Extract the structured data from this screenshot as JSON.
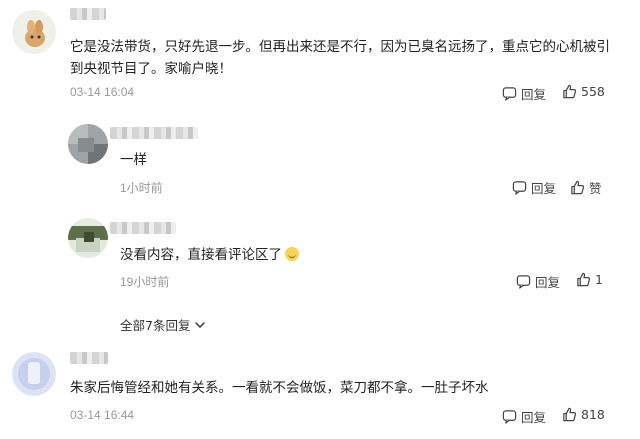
{
  "comments": [
    {
      "text": "它是没法带货，只好先退一步。但再出来还是不行，因为已臭名远扬了，重点它的心机被引到央视节目了。家喻户晓！",
      "time": "03-14 16:04",
      "reply_label": "回复",
      "like_count": "558"
    },
    {
      "text": "一样",
      "time": "1小时前",
      "reply_label": "回复",
      "like_count": "赞"
    },
    {
      "text": "没看内容，直接看评论区了",
      "time": "19小时前",
      "reply_label": "回复",
      "like_count": "1"
    },
    {
      "text": "朱家后悔管经和她有关系。一看就不会做饭，菜刀都不拿。一肚子坏水",
      "time": "03-14 16:44",
      "reply_label": "回复",
      "like_count": "818"
    }
  ],
  "expand_replies": {
    "label": "全部7条回复"
  },
  "icons": {
    "reply": "reply-bubble-icon",
    "like": "thumbs-up-icon",
    "expand": "chevron-down-icon",
    "emoji": "smile-emoji-icon"
  }
}
